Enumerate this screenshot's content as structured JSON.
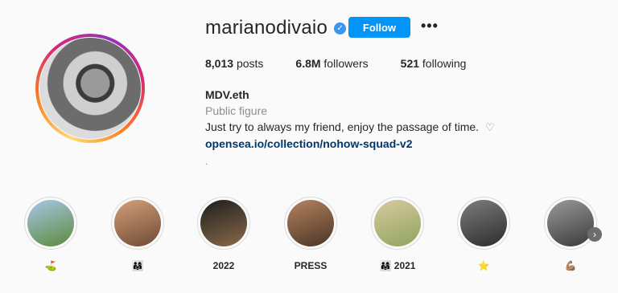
{
  "profile": {
    "username": "marianodivaio",
    "follow_label": "Follow",
    "more_label": "•••",
    "stats": {
      "posts_count": "8,013",
      "posts_label": "posts",
      "followers_count": "6.8M",
      "followers_label": "followers",
      "following_count": "521",
      "following_label": "following"
    },
    "bio": {
      "name": "MDV.eth",
      "category": "Public figure",
      "text": "Just try to always my friend, enjoy the passage of time.",
      "heart": "♡",
      "link": "opensea.io/collection/nohow-squad-v2",
      "extra": "."
    }
  },
  "highlights": [
    {
      "label": "⛳",
      "colors": [
        "#a9c6e8",
        "#5b8a3a"
      ]
    },
    {
      "label": "👨‍👩‍👧",
      "colors": [
        "#d4a07a",
        "#6e4a34"
      ]
    },
    {
      "label": "2022",
      "colors": [
        "#1e1e1e",
        "#8a6a4a"
      ]
    },
    {
      "label": "PRESS",
      "colors": [
        "#b5835e",
        "#4a3426"
      ]
    },
    {
      "label": "👨‍👩‍👧 2021",
      "colors": [
        "#d9c9a0",
        "#8ea45e"
      ]
    },
    {
      "label": "⭐",
      "colors": [
        "#7d7d7d",
        "#2c2c2c"
      ]
    },
    {
      "label": "💪🏽",
      "colors": [
        "#9a9a9a",
        "#3a3a3a"
      ]
    }
  ],
  "accent_color": "#0095f6"
}
